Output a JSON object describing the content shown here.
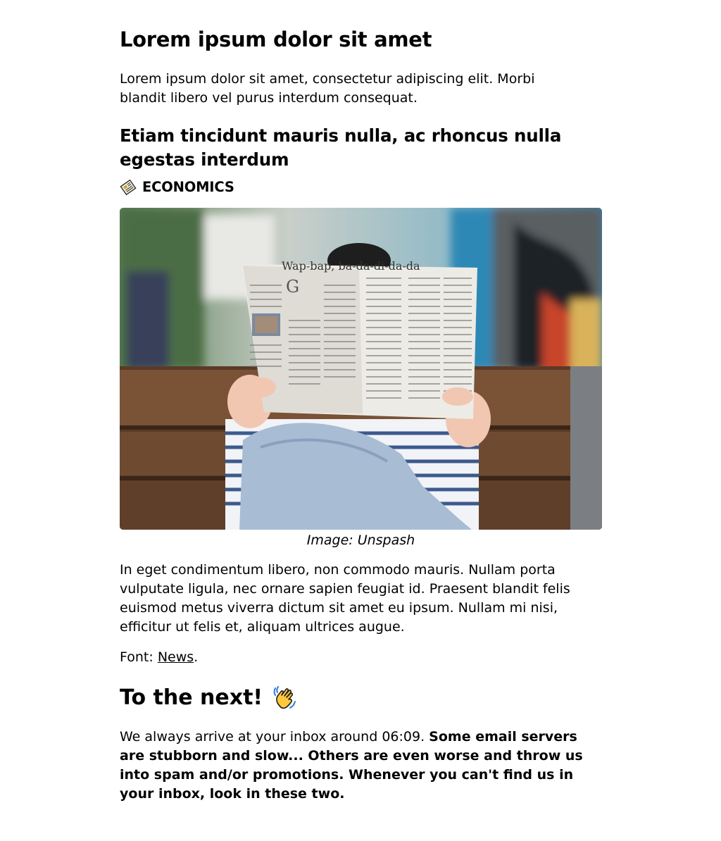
{
  "article": {
    "title": "Lorem ipsum dolor sit amet",
    "intro": "Lorem ipsum dolor sit amet, consectetur adipiscing elit. Morbi blandit libero vel purus interdum consequat.",
    "subtitle": "Etiam tincidunt mauris nulla, ac rhoncus nulla egestas interdum",
    "category": {
      "label": "ECONOMICS",
      "icon": "newspaper-icon"
    },
    "image": {
      "subject": "person-reading-newspaper-photo",
      "caption": "Image: Unspash",
      "headline": "Wap-bap, ba-da-di-da-da"
    },
    "body": "In eget condimentum libero, non commodo mauris. Nullam porta vulputate ligula, nec ornare sapien feugiat id. Praesent blandit felis euismod metus viverra dictum sit amet eu ipsum. Nullam mi nisi, efficitur ut felis et, aliquam ultrices augue.",
    "source": {
      "prefix": "Font: ",
      "link_text": "News",
      "suffix": "."
    }
  },
  "closing": {
    "heading": "To the next!",
    "icon": "waving-hand-icon",
    "text_plain": "We always arrive at your inbox around 06:09. ",
    "text_bold": "Some email servers are stubborn and slow... Others are even worse and throw us into spam and/or promotions. Whenever you can't find us in your inbox, look in these two."
  },
  "colors": {
    "text": "#000000",
    "background": "#ffffff"
  }
}
